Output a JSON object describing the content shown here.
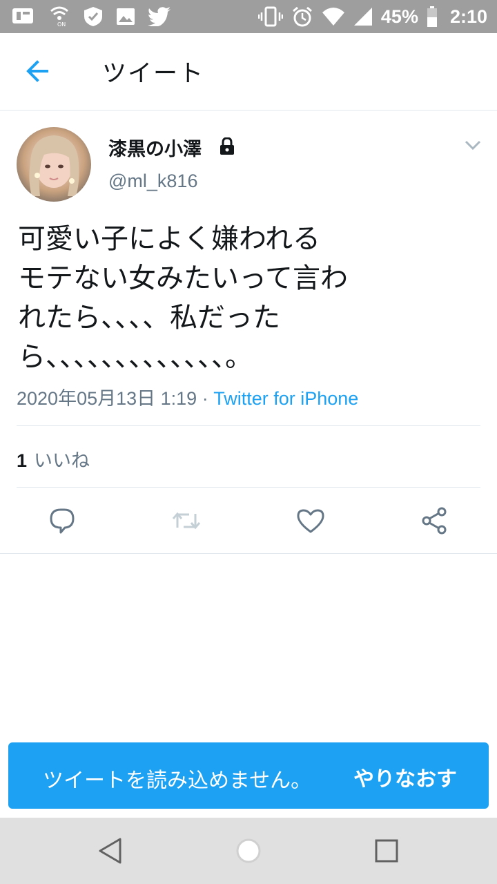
{
  "status_bar": {
    "battery": "45%",
    "time": "2:10",
    "left_icons": [
      "notification-icon",
      "wifi-calling-icon",
      "shield-icon",
      "image-icon",
      "twitter-icon"
    ],
    "right_icons": [
      "vibrate-icon",
      "alarm-icon",
      "wifi-icon",
      "signal-icon",
      "battery-icon"
    ]
  },
  "app_bar": {
    "title": "ツイート"
  },
  "tweet": {
    "author_name": "漆黒の小澤",
    "author_handle": "@ml_k816",
    "text_lines": [
      "可愛い子によく嫌われる",
      "モテない女みたいって言わ",
      "れたら、、、、私だった",
      "ら、、、、、、、、、、、、、。"
    ],
    "timestamp": "2020年05月13日 1:19",
    "separator": " · ",
    "client": "Twitter for iPhone",
    "likes_count": "1",
    "likes_label": "いいね"
  },
  "actions": [
    "reply-icon",
    "retweet-icon",
    "like-icon",
    "share-icon"
  ],
  "snackbar": {
    "message": "ツイートを読み込めません。",
    "action": "やりなおす"
  },
  "colors": {
    "accent": "#1da1f2",
    "status_bar": "#9e9e9e",
    "secondary_text": "#657786",
    "primary_text": "#14171a",
    "nav_bar": "#e0e0e0"
  }
}
